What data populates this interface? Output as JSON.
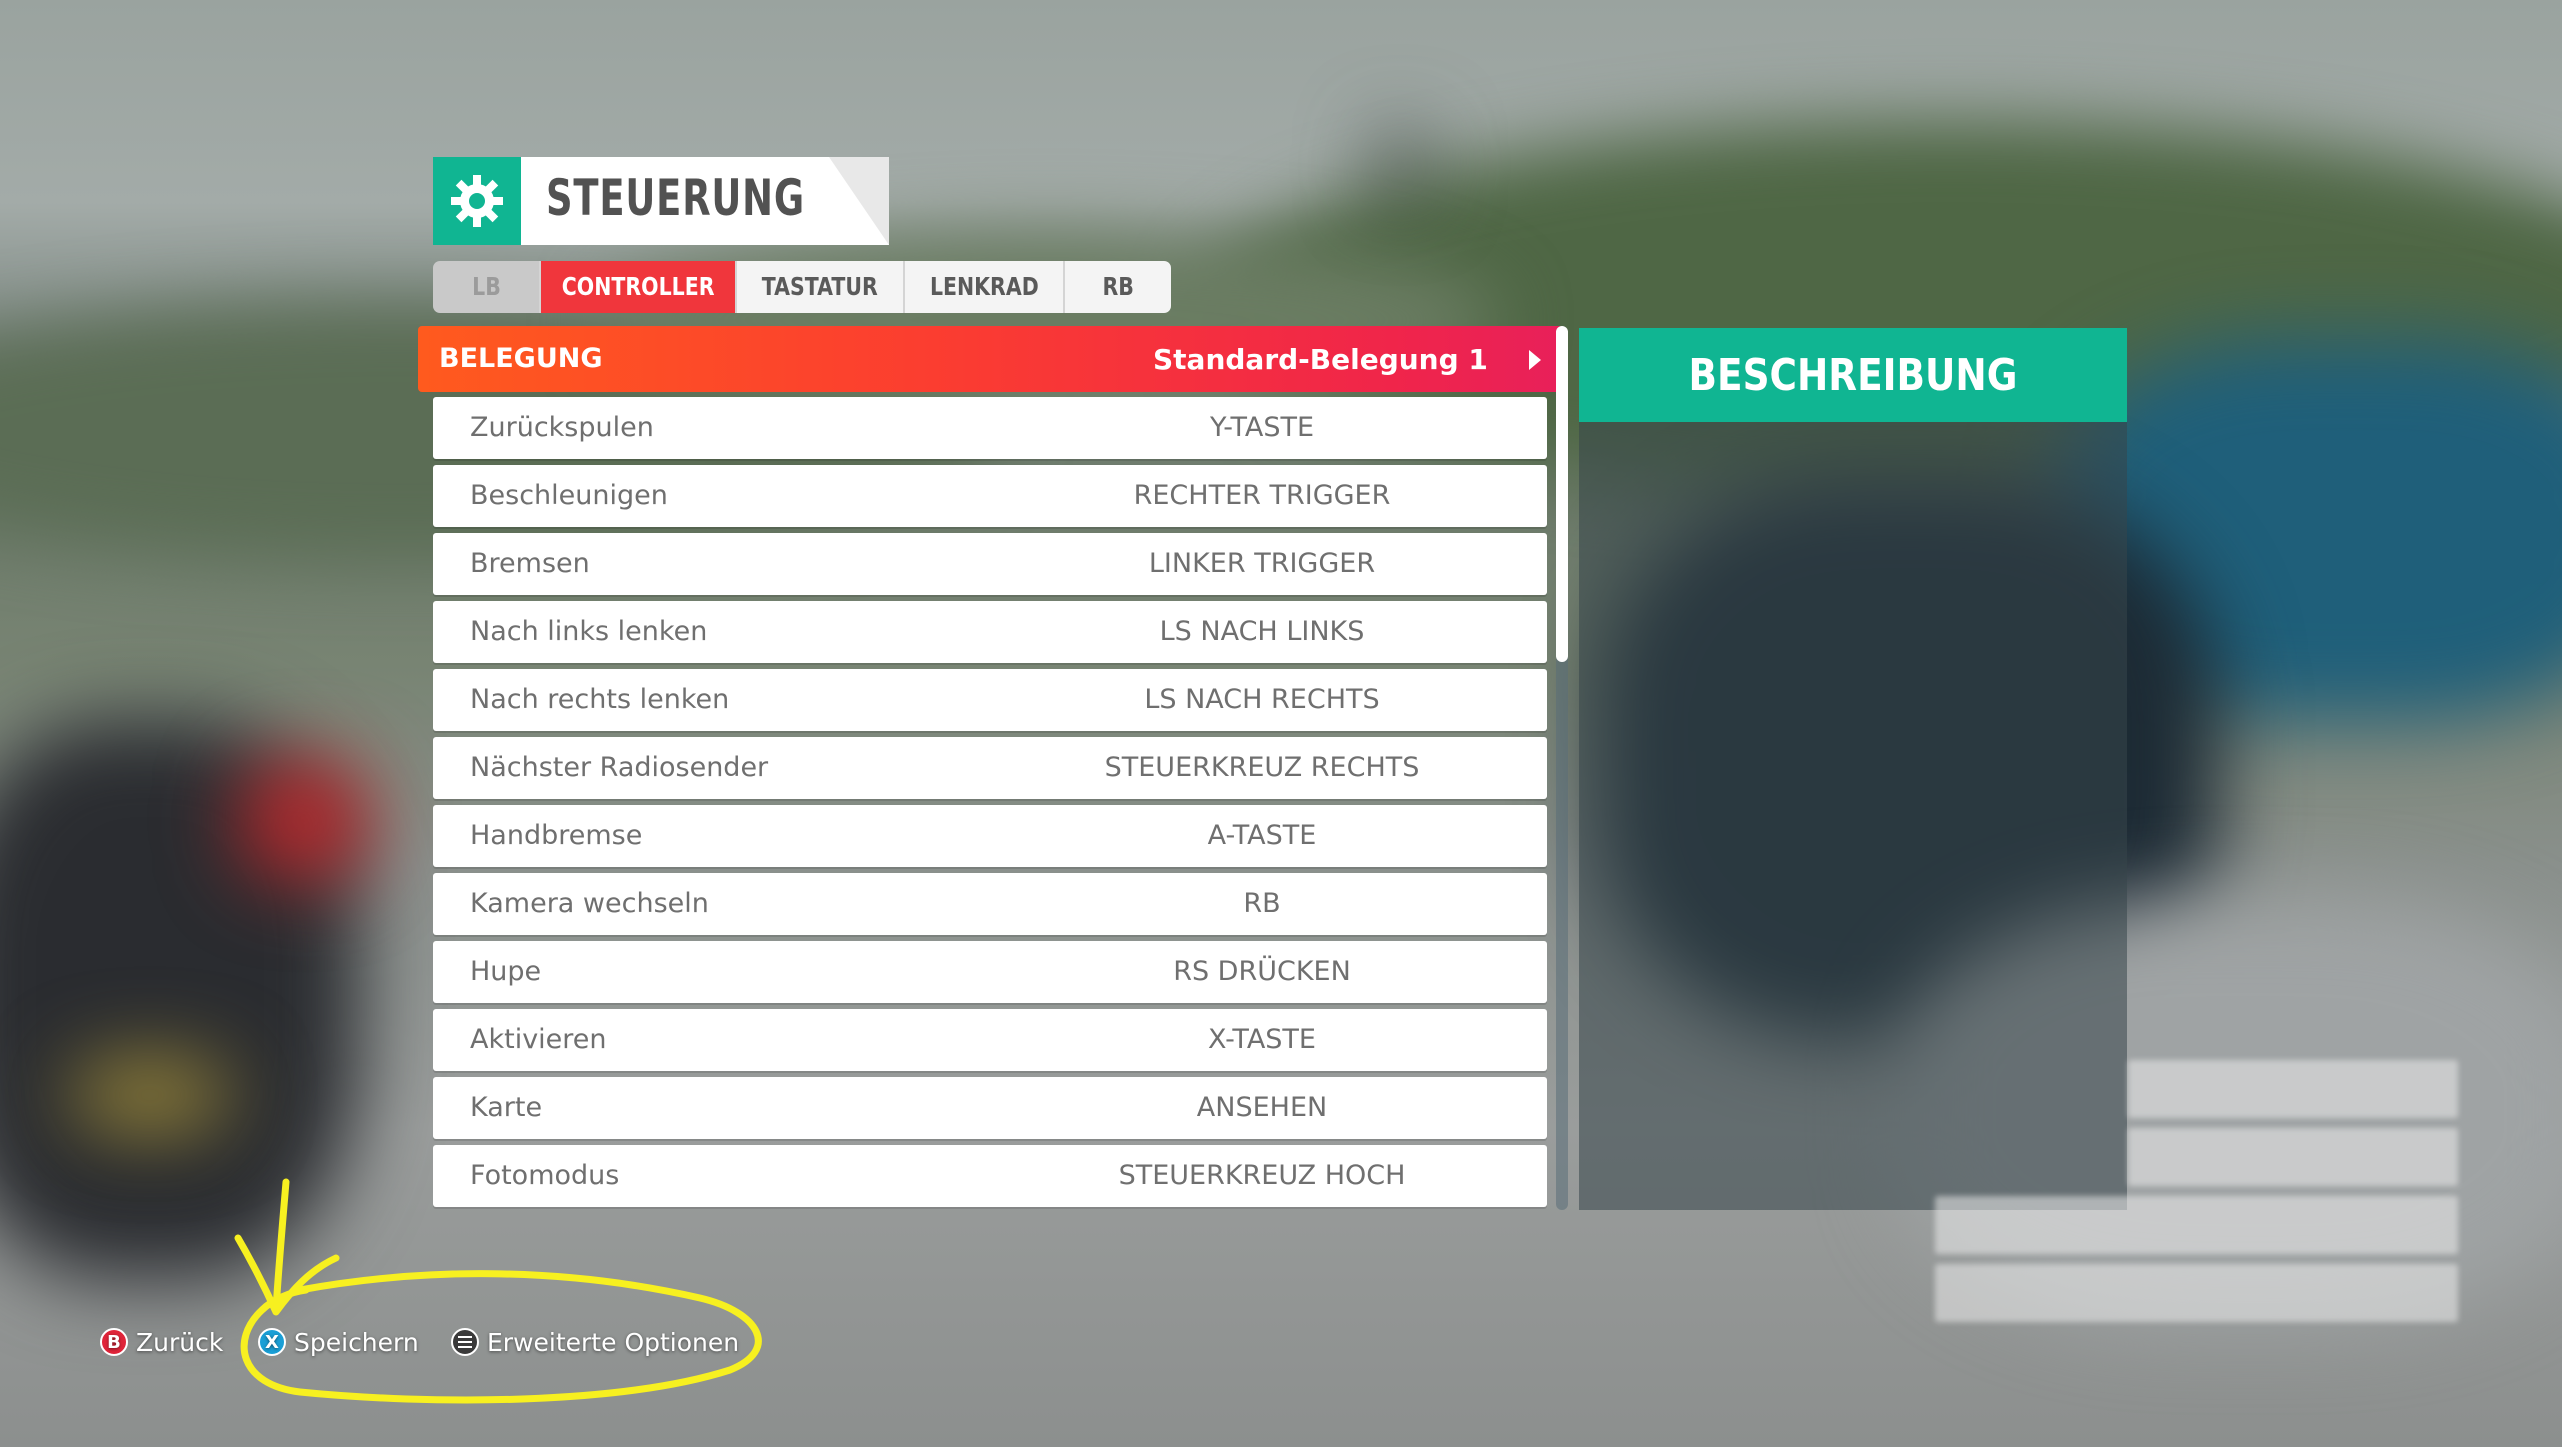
{
  "screen": {
    "title": "STEUERUNG"
  },
  "tabs": [
    {
      "label": "LB",
      "active": false
    },
    {
      "label": "CONTROLLER",
      "active": true
    },
    {
      "label": "TASTATUR",
      "active": false
    },
    {
      "label": "LENKRAD",
      "active": false
    },
    {
      "label": "RB",
      "active": false
    }
  ],
  "preset": {
    "label": "BELEGUNG",
    "value": "Standard-Belegung 1"
  },
  "bindings": [
    {
      "action": "Zurückspulen",
      "binding": "Y-TASTE"
    },
    {
      "action": "Beschleunigen",
      "binding": "RECHTER TRIGGER"
    },
    {
      "action": "Bremsen",
      "binding": "LINKER TRIGGER"
    },
    {
      "action": "Nach links lenken",
      "binding": "LS NACH LINKS"
    },
    {
      "action": "Nach rechts lenken",
      "binding": "LS NACH RECHTS"
    },
    {
      "action": "Nächster Radiosender",
      "binding": "STEUERKREUZ RECHTS"
    },
    {
      "action": "Handbremse",
      "binding": "A-TASTE"
    },
    {
      "action": "Kamera wechseln",
      "binding": "RB"
    },
    {
      "action": "Hupe",
      "binding": "RS DRÜCKEN"
    },
    {
      "action": "Aktivieren",
      "binding": "X-TASTE"
    },
    {
      "action": "Karte",
      "binding": "ANSEHEN"
    },
    {
      "action": "Fotomodus",
      "binding": "STEUERKREUZ HOCH"
    }
  ],
  "description": {
    "title": "BESCHREIBUNG"
  },
  "footer": {
    "back": {
      "glyph": "B",
      "label": "Zurück"
    },
    "save": {
      "glyph": "X",
      "label": "Speichern"
    },
    "more": {
      "label": "Erweiterte Optionen"
    }
  },
  "colors": {
    "accent_green": "#10b592",
    "accent_red": "#f0363c",
    "annotation_yellow": "#f7f020"
  },
  "icons": [
    "gear-icon",
    "b-button-icon",
    "x-button-icon",
    "menu-button-icon",
    "arrow-right-icon"
  ]
}
